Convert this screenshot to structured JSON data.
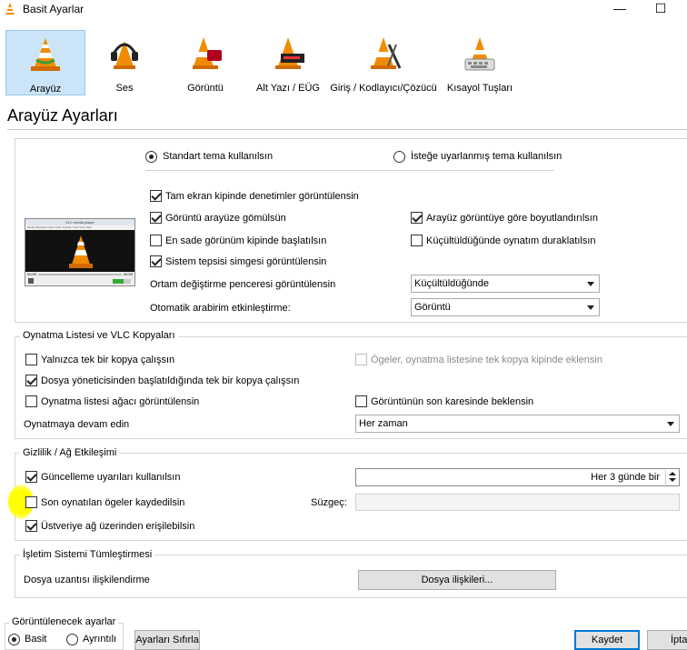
{
  "window": {
    "title": "Basit Ayarlar",
    "minimize": "—",
    "maximize": "☐"
  },
  "toolbar": {
    "items": [
      {
        "label": "Arayüz",
        "icon": "vlc-cone-icon",
        "selected": true
      },
      {
        "label": "Ses",
        "icon": "headphones-icon",
        "selected": false
      },
      {
        "label": "Görüntü",
        "icon": "video-icon",
        "selected": false
      },
      {
        "label": "Alt Yazı / EÜG",
        "icon": "subtitles-icon",
        "selected": false
      },
      {
        "label": "Giriş / Kodlayıcı/Çözücü",
        "icon": "input-codec-icon",
        "selected": false
      },
      {
        "label": "Kısayol Tuşları",
        "icon": "hotkeys-icon",
        "selected": false
      }
    ]
  },
  "heading": "Arayüz Ayarları",
  "theme": {
    "standard": "Standart tema kullanılsın",
    "custom": "İsteğe uyarlanmış tema kullanılsın"
  },
  "interface_options": {
    "fullscreen_controls": "Tam ekran kipinde denetimler görüntülensin",
    "embed_video": "Görüntü arayüze gömülsün",
    "resize_interface": "Arayüz görüntüye göre boyutlandırılsın",
    "minimal_mode": "En sade görünüm kipinde başlatılsın",
    "pause_minimized": "Küçültüldüğünde oynatım duraklatılsın",
    "systray": "Sistem tepsisi simgesi görüntülensin",
    "popup_label": "Ortam değiştirme penceresi görüntülensin",
    "popup_value": "Küçültüldüğünde",
    "auto_raise_label": "Otomatik arabirim etkinleştirme:",
    "auto_raise_value": "Görüntü"
  },
  "playlist": {
    "legend": "Oynatma Listesi ve VLC Kopyaları",
    "one_instance": "Yalnızca tek bir kopya çalışsın",
    "enqueue": "Ögeler, oynatma listesine tek kopya kipinde eklensin",
    "one_instance_file": "Dosya yöneticisinden başlatıldığında tek bir kopya çalışsın",
    "playlist_tree": "Oynatma listesi ağacı görüntülensin",
    "pause_last_frame": "Görüntünün son karesinde beklensin",
    "continue_label": "Oynatmaya devam edin",
    "continue_value": "Her zaman"
  },
  "privacy": {
    "legend": "Gizlilik / Ağ Etkileşimi",
    "updates": "Güncelleme uyarıları kullanılsın",
    "updates_value": "Her 3 günde bir",
    "recent": "Son oynatılan ögeler kaydedilsin",
    "filter_label": "Süzgeç:",
    "metadata": "Üstveriye ağ üzerinden erişilebilsin"
  },
  "os": {
    "legend": "İşletim Sistemi Tümleştirmesi",
    "assoc_label": "Dosya uzantısı ilişkilendirme",
    "assoc_button": "Dosya ilişkileri..."
  },
  "footer": {
    "legend": "Görüntülenecek ayarlar",
    "basic": "Basit",
    "advanced": "Ayrıntılı",
    "reset": "Ayarları Sıfırla",
    "save": "Kaydet",
    "cancel": "İptal"
  },
  "preview": {
    "title": "VLC media player",
    "menu": "Media Playback Audio Video Subtitle Tools View Help",
    "time_start": "00:00",
    "time_end": "00:00"
  },
  "colors": {
    "accent": "#0078d7",
    "highlight": "#ffff00",
    "selected_tab": "#cce4f7",
    "vlc_orange": "#f08c00"
  }
}
